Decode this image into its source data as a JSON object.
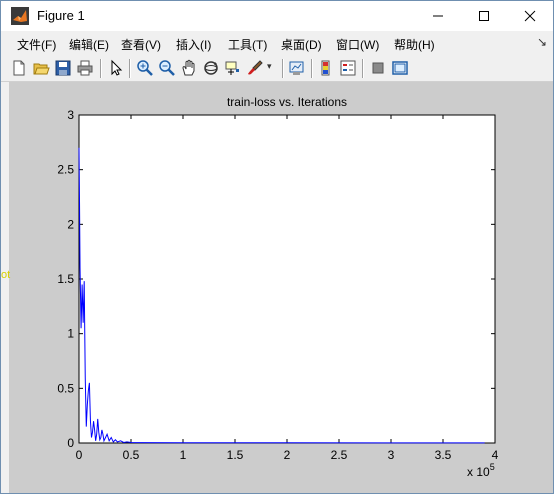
{
  "window": {
    "title": "Figure 1",
    "controls": {
      "minimize": "—",
      "maximize": "☐",
      "close": "✕"
    }
  },
  "menu": {
    "items": [
      "文件(F)",
      "编辑(E)",
      "查看(V)",
      "插入(I)",
      "工具(T)",
      "桌面(D)",
      "窗口(W)",
      "帮助(H)"
    ],
    "overflow_arrow": "↘"
  },
  "toolbar": {
    "buttons": [
      "new-figure-icon",
      "open-file-icon",
      "save-icon",
      "print-icon",
      "pointer-icon",
      "zoom-in-icon",
      "zoom-out-icon",
      "pan-hand-icon",
      "rotate-3d-icon",
      "data-cursor-icon",
      "brush-icon",
      "link-plot-icon",
      "colorbar-icon",
      "legend-icon",
      "hide-plot-tools-icon",
      "show-plot-tools-icon"
    ]
  },
  "side_mark": "ot",
  "colors": {
    "line": "#0000ff",
    "figure_bg": "#cccccc",
    "axes_bg": "#ffffff"
  },
  "chart_data": {
    "type": "line",
    "title": "train-loss vs. Iterations",
    "xlabel": "",
    "ylabel": "",
    "x_exponent_label": "x 10",
    "x_exponent_power": "5",
    "xlim": [
      0,
      4
    ],
    "ylim": [
      0,
      3
    ],
    "xticks": [
      "0",
      "0.5",
      "1",
      "1.5",
      "2",
      "2.5",
      "3",
      "3.5",
      "4"
    ],
    "yticks": [
      "0",
      "0.5",
      "1",
      "1.5",
      "2",
      "2.5",
      "3"
    ],
    "grid": false,
    "series": [
      {
        "color": "#0000ff",
        "x": [
          0,
          0.005,
          0.01,
          0.02,
          0.03,
          0.04,
          0.05,
          0.06,
          0.07,
          0.08,
          0.09,
          0.1,
          0.11,
          0.12,
          0.13,
          0.14,
          0.15,
          0.16,
          0.17,
          0.18,
          0.19,
          0.2,
          0.21,
          0.22,
          0.23,
          0.24,
          0.25,
          0.27,
          0.29,
          0.31,
          0.33,
          0.35,
          0.37,
          0.4,
          0.43,
          0.46,
          0.5,
          0.6,
          1.0,
          2.0,
          3.0,
          3.9
        ],
        "y": [
          2.7,
          2.2,
          1.6,
          1.05,
          1.45,
          1.1,
          1.48,
          0.6,
          0.15,
          0.35,
          0.48,
          0.55,
          0.2,
          0.05,
          0.1,
          0.2,
          0.12,
          0.02,
          0.08,
          0.22,
          0.1,
          0.03,
          0.05,
          0.12,
          0.08,
          0.02,
          0.04,
          0.08,
          0.02,
          0.05,
          0.01,
          0.03,
          0.01,
          0.02,
          0.005,
          0.01,
          0.005,
          0.003,
          0.002,
          0.002,
          0.001,
          0.001
        ]
      }
    ]
  }
}
